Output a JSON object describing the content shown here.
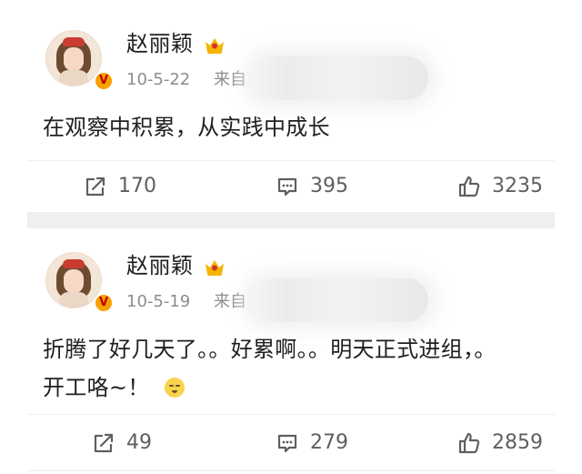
{
  "posts": [
    {
      "user": "赵丽颖",
      "date": "10-5-22",
      "source_prefix": "来自",
      "text": "在观察中积累，从实践中成长",
      "actions": {
        "repost": "170",
        "comment": "395",
        "like": "3235"
      }
    },
    {
      "user": "赵丽颖",
      "date": "10-5-19",
      "source_prefix": "来自",
      "text_line_1": "折腾了好几天了。。好累啊。。明天正式进组，。",
      "text_line_2": "开工咯~！",
      "actions": {
        "repost": "49",
        "comment": "279",
        "like": "2859"
      }
    }
  ],
  "icons": {
    "avatar": "avatar-icon",
    "vip_badge": "vip-badge-icon",
    "crown": "crown-icon",
    "repost": "repost-icon",
    "comment": "comment-icon",
    "like": "like-icon",
    "emoji": "sweat-emoji-icon"
  },
  "colors": {
    "text": "#1f1f1f",
    "meta": "#8d8d8d",
    "icon": "#5f5f5f",
    "crown_gold": "#f6b400",
    "crown_red": "#d42f2f",
    "vip_orange": "#f6a200",
    "separator": "#efefef"
  }
}
